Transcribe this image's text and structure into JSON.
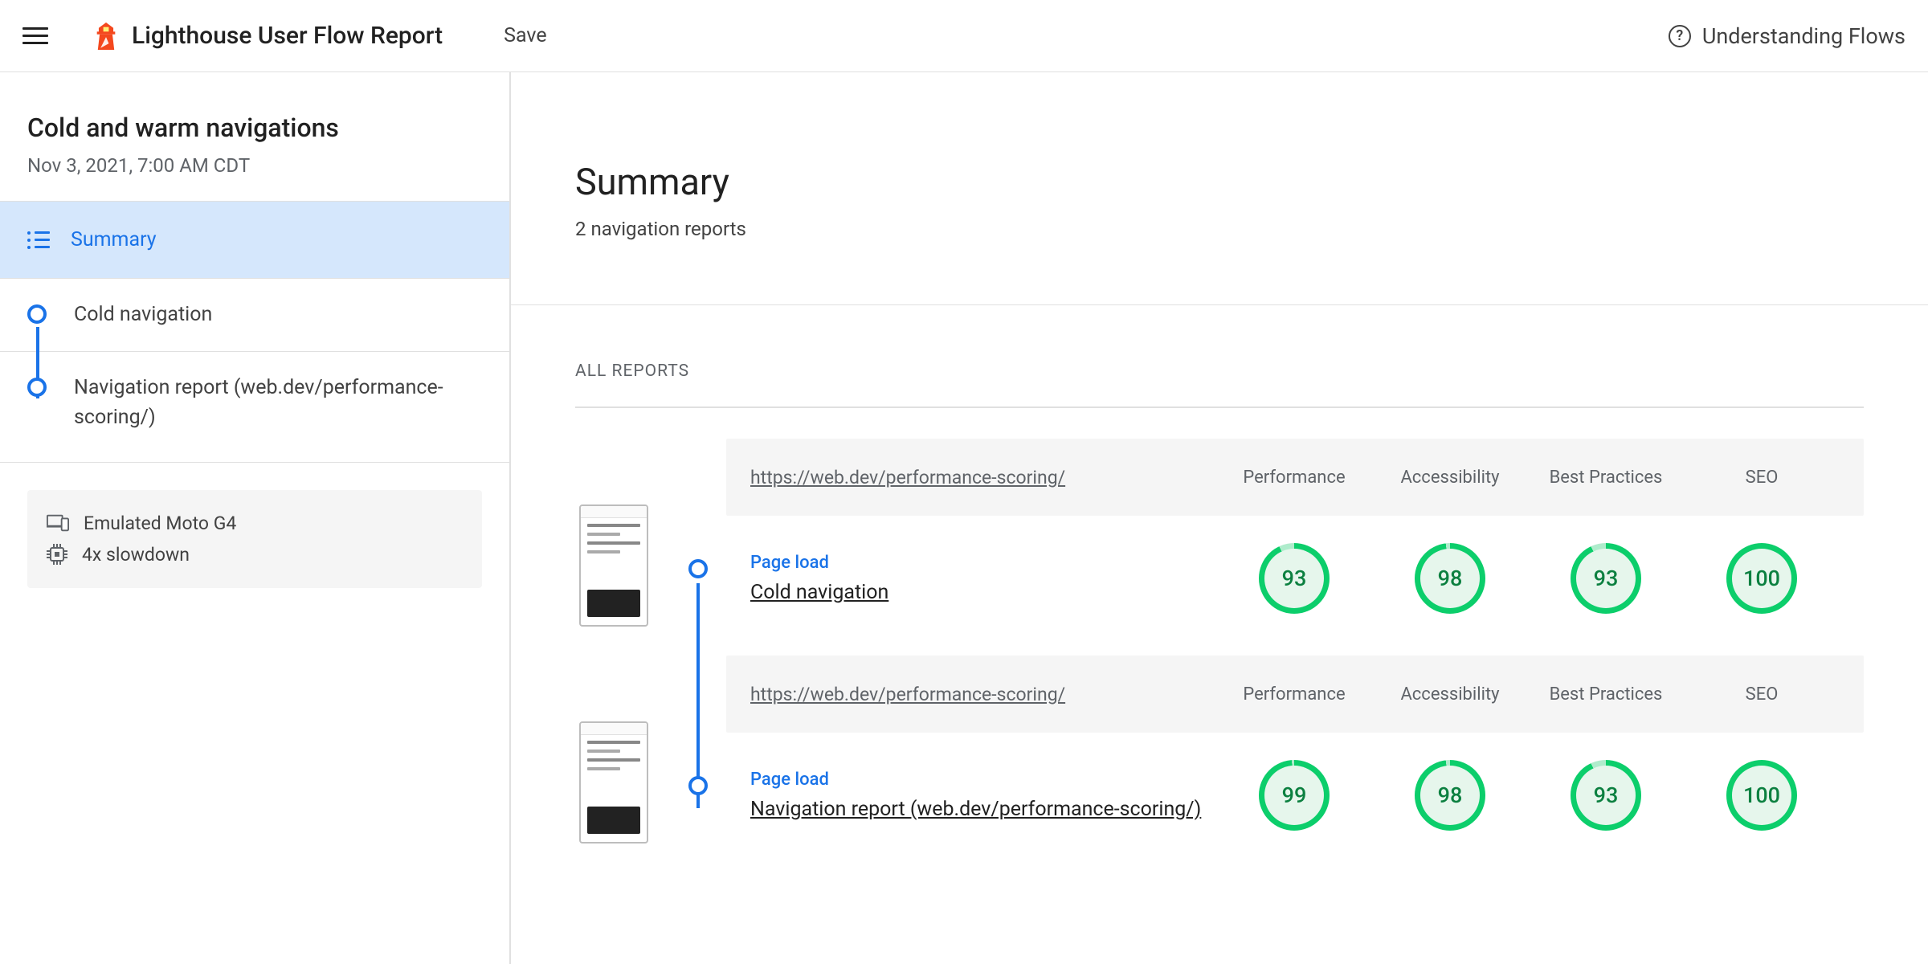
{
  "header": {
    "app_title": "Lighthouse User Flow Report",
    "save": "Save",
    "help": "Understanding Flows"
  },
  "sidebar": {
    "flow_title": "Cold and warm navigations",
    "flow_date": "Nov 3, 2021, 7:00 AM CDT",
    "summary_label": "Summary",
    "steps": [
      {
        "label": "Cold navigation"
      },
      {
        "label": "Navigation report (web.dev/performance-scoring/)"
      }
    ],
    "device": "Emulated Moto G4",
    "cpu": "4x slowdown"
  },
  "main": {
    "title": "Summary",
    "subtitle": "2 navigation reports",
    "all_reports_label": "ALL REPORTS",
    "columns": [
      "Performance",
      "Accessibility",
      "Best Practices",
      "SEO"
    ],
    "reports": [
      {
        "url": "https://web.dev/performance-scoring/",
        "step_type": "Page load",
        "step_name": "Cold navigation",
        "scores": [
          93,
          98,
          93,
          100
        ]
      },
      {
        "url": "https://web.dev/performance-scoring/",
        "step_type": "Page load",
        "step_name": "Navigation report (web.dev/performance-scoring/)",
        "scores": [
          99,
          98,
          93,
          100
        ]
      }
    ]
  },
  "colors": {
    "pass": "#0cce6b",
    "pass_text": "#0c8040",
    "accent": "#1a73e8"
  }
}
